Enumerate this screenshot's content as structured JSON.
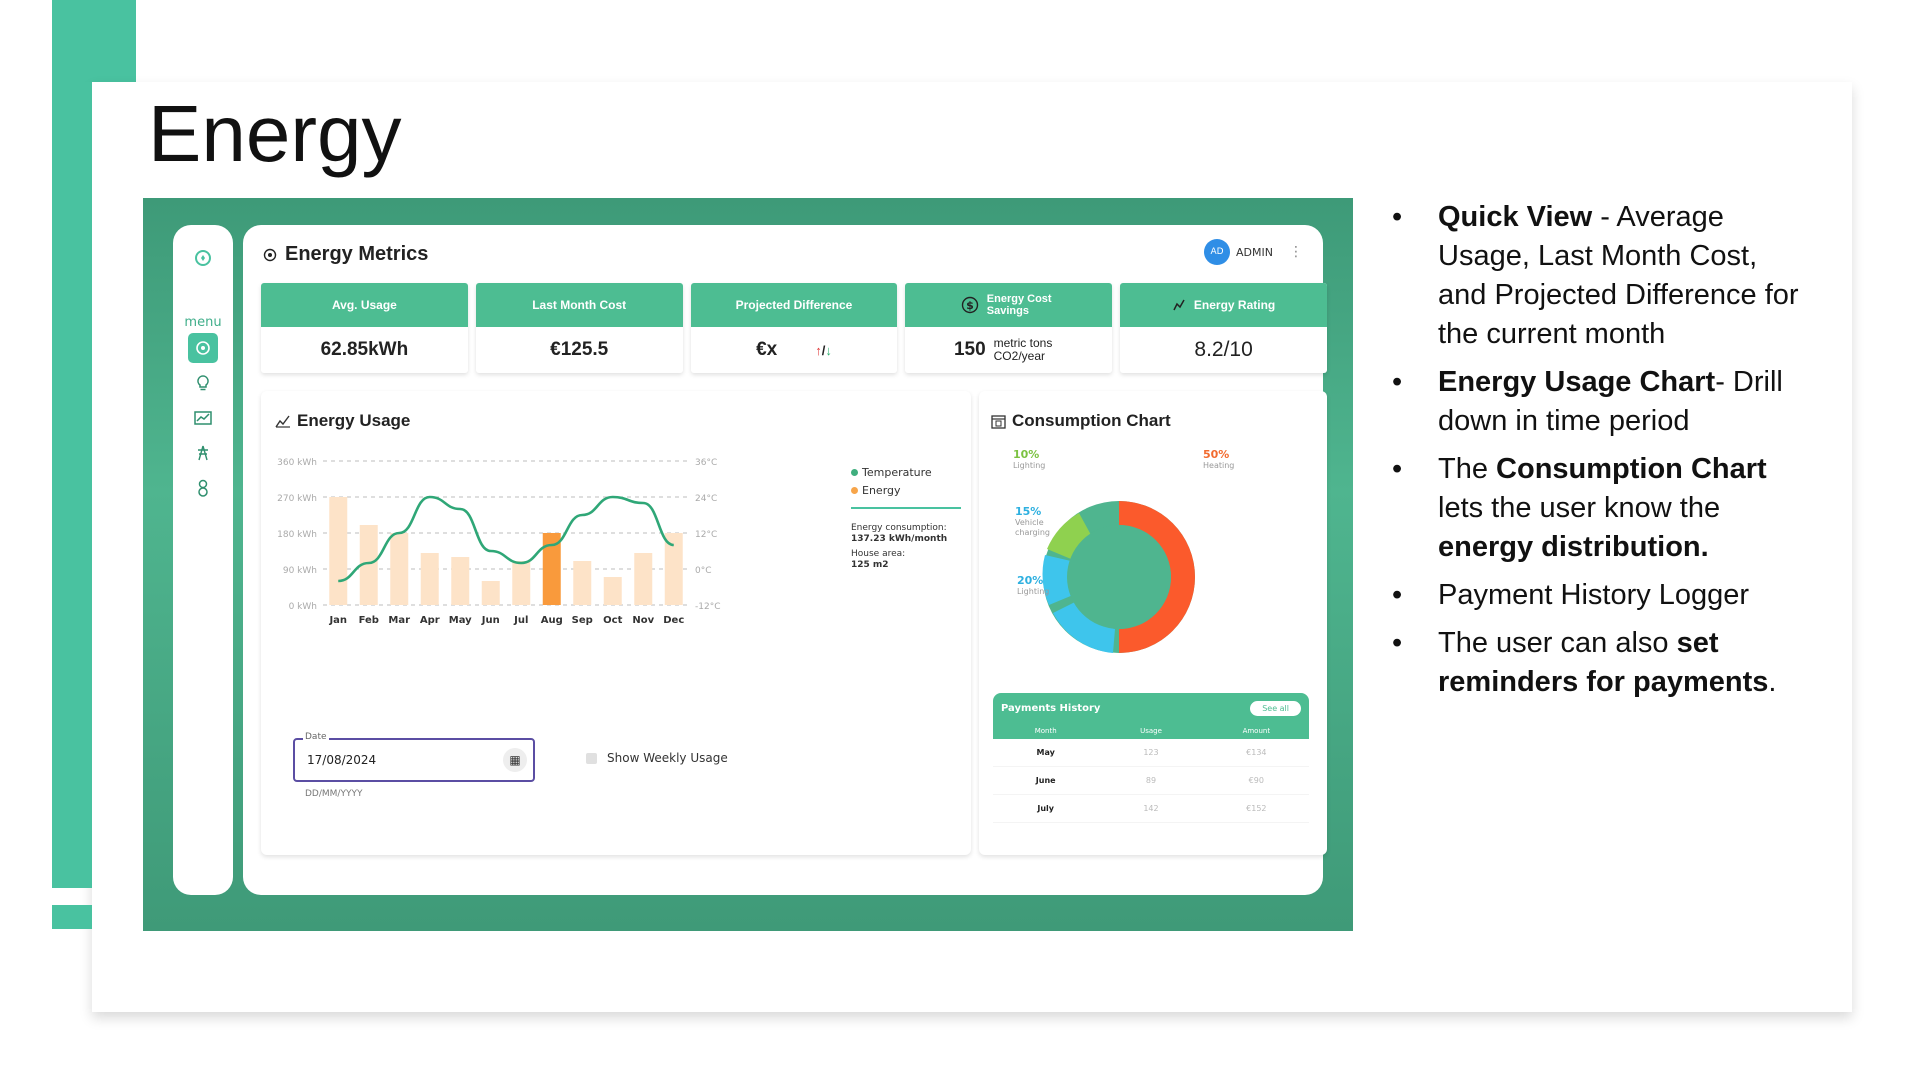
{
  "slide": {
    "title": "Energy",
    "bullets": [
      {
        "parts": [
          {
            "text": "Quick View",
            "bold": true
          },
          {
            "text": " - Average Usage, Last Month Cost, and Projected Difference for the current month",
            "bold": false
          }
        ]
      },
      {
        "parts": [
          {
            "text": " Energy Usage Chart",
            "bold": true
          },
          {
            "text": "- Drill down in time period",
            "bold": false
          }
        ]
      },
      {
        "parts": [
          {
            "text": "The ",
            "bold": false
          },
          {
            "text": "Consumption Chart",
            "bold": true
          },
          {
            "text": " lets the user know the ",
            "bold": false
          },
          {
            "text": "energy distribution.",
            "bold": true
          }
        ]
      },
      {
        "parts": [
          {
            "text": "Payment History Logger",
            "bold": false
          }
        ]
      },
      {
        "parts": [
          {
            "text": "The user can also ",
            "bold": false
          },
          {
            "text": "set reminders for payments",
            "bold": true
          },
          {
            "text": ".",
            "bold": false
          }
        ]
      }
    ]
  },
  "app": {
    "menu_label": "menu",
    "title": "Energy Metrics",
    "user_initials": "AD",
    "user_role": "ADMIN",
    "metrics": [
      {
        "label": "Avg. Usage",
        "value": "62.85kWh"
      },
      {
        "label": "Last Month Cost",
        "value": "€125.5"
      },
      {
        "label": "Projected Difference",
        "value": "€x",
        "arrow_up": "↑",
        "slash": "/",
        "arrow_down": "↓"
      },
      {
        "label": "Energy Cost Savings",
        "value": "150",
        "unit": "metric tons CO2/year"
      },
      {
        "label": "Energy Rating",
        "value": "8.2/10"
      }
    ],
    "usage": {
      "title": "Energy Usage",
      "legend": [
        {
          "name": "Temperature",
          "color": "#3fae7e"
        },
        {
          "name": "Energy",
          "color": "#f7a54a"
        }
      ],
      "notes": [
        {
          "label": "Energy consumption:",
          "value": "137.23 kWh/month"
        },
        {
          "label": "House area:",
          "value": "125 m2"
        }
      ],
      "date_label": "Date",
      "date_value": "17/08/2024",
      "date_help": "DD/MM/YYYY",
      "weekly_label": "Show Weekly Usage"
    },
    "consumption": {
      "title": "Consumption Chart",
      "slices": [
        {
          "pct": "50%",
          "name": "Heating",
          "color": "#fb5a2c"
        },
        {
          "pct": "20%",
          "name": "Lighting",
          "color": "#3ec5ec"
        },
        {
          "pct": "15%",
          "name": "Vehicle charging",
          "color": "#34b8e6"
        },
        {
          "pct": "10%",
          "name": "Lighting",
          "color": "#8fd14f"
        }
      ],
      "label_colors": {
        "green": "#7cc242",
        "orange": "#f26b2f",
        "blue": "#2eb0e0",
        "teal": "#3fae8a"
      }
    },
    "payments": {
      "title": "Payments History",
      "see_all": "See all",
      "columns": [
        "Month",
        "Usage",
        "Amount"
      ],
      "rows": [
        [
          "May",
          "123",
          "€134"
        ],
        [
          "June",
          "89",
          "€90"
        ],
        [
          "July",
          "142",
          "€152"
        ]
      ]
    }
  },
  "chart_data": {
    "type": "bar",
    "categories": [
      "Jan",
      "Feb",
      "Mar",
      "Apr",
      "May",
      "Jun",
      "Jul",
      "Aug",
      "Sep",
      "Oct",
      "Nov",
      "Dec"
    ],
    "series": [
      {
        "name": "Energy",
        "axis": "left",
        "type": "bar",
        "values": [
          270,
          200,
          180,
          130,
          120,
          60,
          110,
          180,
          110,
          70,
          130,
          180
        ],
        "highlight_index": 7
      },
      {
        "name": "Temperature",
        "axis": "right",
        "type": "line",
        "values": [
          -4,
          2,
          12,
          24,
          20,
          6,
          2,
          8,
          18,
          24,
          22,
          8
        ]
      }
    ],
    "y_left_ticks": [
      "360 kWh",
      "270 kWh",
      "180 kWh",
      "90 kWh",
      "0 kWh"
    ],
    "y_right_ticks": [
      "36°C",
      "24°C",
      "12°C",
      "0°C",
      "-12°C"
    ],
    "ylim_left": [
      0,
      360
    ],
    "ylim_right": [
      -12,
      36
    ],
    "grid": true
  }
}
